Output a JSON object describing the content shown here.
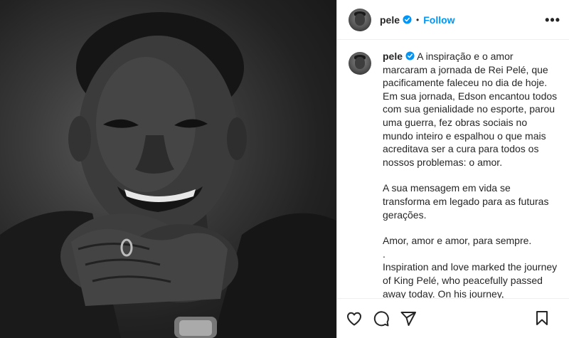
{
  "header": {
    "username": "pele",
    "separator": "•",
    "follow_label": "Follow",
    "more_label": "•••"
  },
  "caption": {
    "username": "pele",
    "lines": [
      "A inspiração e o amor marcaram a jornada de Rei Pelé, que pacificamente faleceu no dia de hoje. Em sua jornada, Edson encantou todos com sua genialidade no esporte, parou uma guerra, fez obras sociais no mundo inteiro e espalhou o que mais acreditava ser a cura para todos os nossos problemas: o amor.",
      "A sua mensagem em vida se transforma em legado para as futuras gerações.",
      "Amor, amor e amor, para sempre.",
      ".",
      "Inspiration and love marked the journey of King Pelé, who peacefully passed away today. On his journey,"
    ]
  },
  "icons": {
    "verified": "verified-badge-icon",
    "like": "heart-icon",
    "comment": "comment-icon",
    "share": "share-icon",
    "save": "bookmark-icon",
    "more": "more-options-icon"
  },
  "colors": {
    "accent": "#0095f6",
    "text": "#262626",
    "border": "#dbdbdb"
  }
}
